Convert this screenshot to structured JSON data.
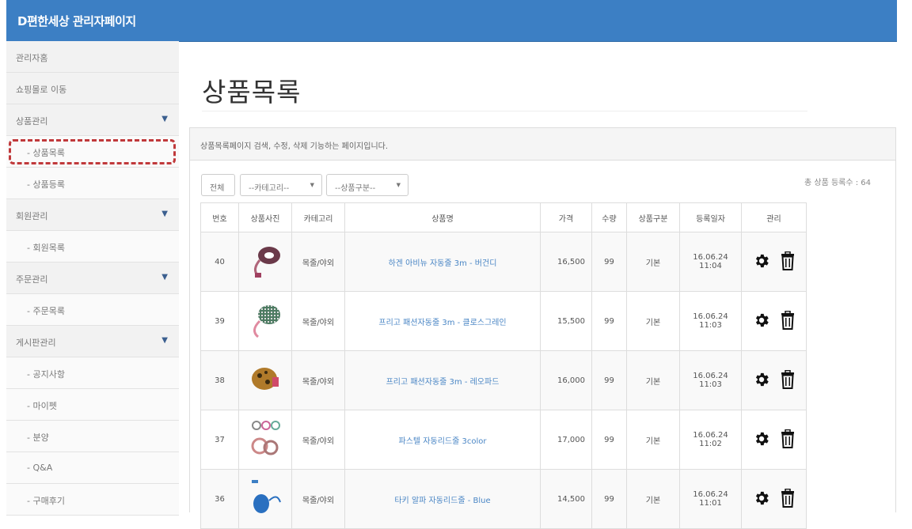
{
  "header": {
    "title": "D편한세상 관리자페이지"
  },
  "sidebar": {
    "items": [
      {
        "label": "관리자홈",
        "sub": false,
        "caret": false
      },
      {
        "label": "쇼핑몰로 이동",
        "sub": false,
        "caret": false
      },
      {
        "label": "상품관리",
        "sub": false,
        "caret": true
      },
      {
        "label": "- 상품목록",
        "sub": true,
        "caret": false
      },
      {
        "label": "- 상품등록",
        "sub": true,
        "caret": false
      },
      {
        "label": "회원관리",
        "sub": false,
        "caret": true
      },
      {
        "label": "- 회원목록",
        "sub": true,
        "caret": false
      },
      {
        "label": "주문관리",
        "sub": false,
        "caret": true
      },
      {
        "label": "- 주문목록",
        "sub": true,
        "caret": false
      },
      {
        "label": "게시판관리",
        "sub": false,
        "caret": true
      },
      {
        "label": "- 공지사항",
        "sub": true,
        "caret": false
      },
      {
        "label": "- 마이펫",
        "sub": true,
        "caret": false
      },
      {
        "label": "- 분양",
        "sub": true,
        "caret": false
      },
      {
        "label": "- Q&A",
        "sub": true,
        "caret": false
      },
      {
        "label": "- 구매후기",
        "sub": true,
        "caret": false
      }
    ],
    "caret_glyph": "▼"
  },
  "main": {
    "title": "상품목록",
    "panel_description": "상품목록페이지 검색, 수정, 삭제 기능하는 페이지입니다.",
    "filters": {
      "all_label": "전체",
      "category_label": "--카테고리--",
      "type_label": "--상품구분--"
    },
    "total_count_label": "총 상품 등록수 : 64",
    "table": {
      "columns": [
        "번호",
        "상품사진",
        "카테고리",
        "상품명",
        "가격",
        "수량",
        "상품구분",
        "등록일자",
        "관리"
      ],
      "rows": [
        {
          "no": "40",
          "category": "목줄/야외",
          "name": "하겐 아비뉴 자동줄 3m - 버건디",
          "price": "16,500",
          "qty": "99",
          "type": "기본",
          "date": "16.06.24",
          "time": "11:04"
        },
        {
          "no": "39",
          "category": "목줄/야외",
          "name": "프리고 패션자동줄 3m - 클로스그레인",
          "price": "15,500",
          "qty": "99",
          "type": "기본",
          "date": "16.06.24",
          "time": "11:03"
        },
        {
          "no": "38",
          "category": "목줄/야외",
          "name": "프리고 패션자동줄 3m - 레오파드",
          "price": "16,000",
          "qty": "99",
          "type": "기본",
          "date": "16.06.24",
          "time": "11:03"
        },
        {
          "no": "37",
          "category": "목줄/야외",
          "name": "파스텔 자동리드줄 3color",
          "price": "17,000",
          "qty": "99",
          "type": "기본",
          "date": "16.06.24",
          "time": "11:02"
        },
        {
          "no": "36",
          "category": "목줄/야외",
          "name": "타키 알파 자동리드줄 - Blue",
          "price": "14,500",
          "qty": "99",
          "type": "기본",
          "date": "16.06.24",
          "time": "11:01"
        }
      ]
    }
  },
  "colors": {
    "header_bg": "#3c7fc4",
    "link": "#4a86c5",
    "highlight_border": "#c0393b",
    "sidebar_bg": "#f2f2f2"
  }
}
